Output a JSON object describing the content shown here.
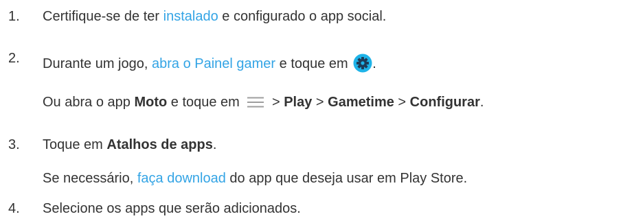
{
  "steps": [
    {
      "number": "1.",
      "before": "Certifique-se de ter ",
      "link": "instalado",
      "after": " e configurado o app social."
    },
    {
      "number": "2.",
      "before": "Durante um jogo, ",
      "link": "abra o Painel gamer",
      "after": " e toque em ",
      "end": ".",
      "alt": {
        "t1": "Ou abra o app ",
        "b1": "Moto",
        "t2": " e toque em ",
        "t3": " > ",
        "b2": "Play",
        "t4": " > ",
        "b3": "Gametime",
        "t5": " > ",
        "b4": "Configurar",
        "t6": "."
      }
    },
    {
      "number": "3.",
      "before": "Toque em ",
      "bold": "Atalhos de apps",
      "after": ".",
      "sub": {
        "before": "Se necessário, ",
        "link": "faça download",
        "after": " do app que deseja usar em Play Store."
      }
    },
    {
      "number": "4.",
      "text": "Selecione os apps que serão adicionados."
    }
  ],
  "icons": {
    "gear": "gear-settings-icon",
    "menu": "hamburger-menu-icon"
  },
  "colors": {
    "text": "#333333",
    "link": "#33a4e5",
    "gear_bg": "#1eb3e8",
    "gear_fg": "#1d3b57",
    "menu": "#9e9e9e"
  }
}
